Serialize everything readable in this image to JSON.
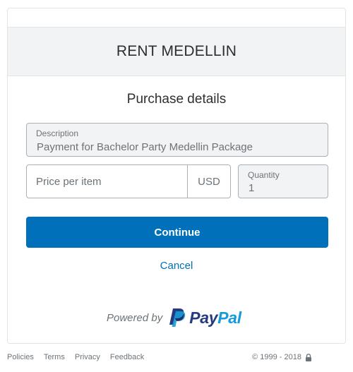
{
  "merchant": {
    "name": "RENT MEDELLIN"
  },
  "section": {
    "title": "Purchase details"
  },
  "description": {
    "label": "Description",
    "value": "Payment for Bachelor Party Medellin  Package"
  },
  "price": {
    "placeholder": "Price per item",
    "currency": "USD"
  },
  "quantity": {
    "label": "Quantity",
    "value": "1"
  },
  "actions": {
    "continue_label": "Continue",
    "cancel_label": "Cancel"
  },
  "branding": {
    "powered_by": "Powered by",
    "logo_part1": "Pay",
    "logo_part2": "Pal"
  },
  "footer": {
    "links": [
      "Policies",
      "Terms",
      "Privacy",
      "Feedback"
    ],
    "copyright": "© 1999 - 2018"
  },
  "colors": {
    "primary": "#0070ba",
    "paypal_dark": "#253b80",
    "paypal_light": "#179bd7"
  },
  "icons": {
    "footer_lock": "lock-icon",
    "paypal_mark": "paypal-logo-icon"
  }
}
